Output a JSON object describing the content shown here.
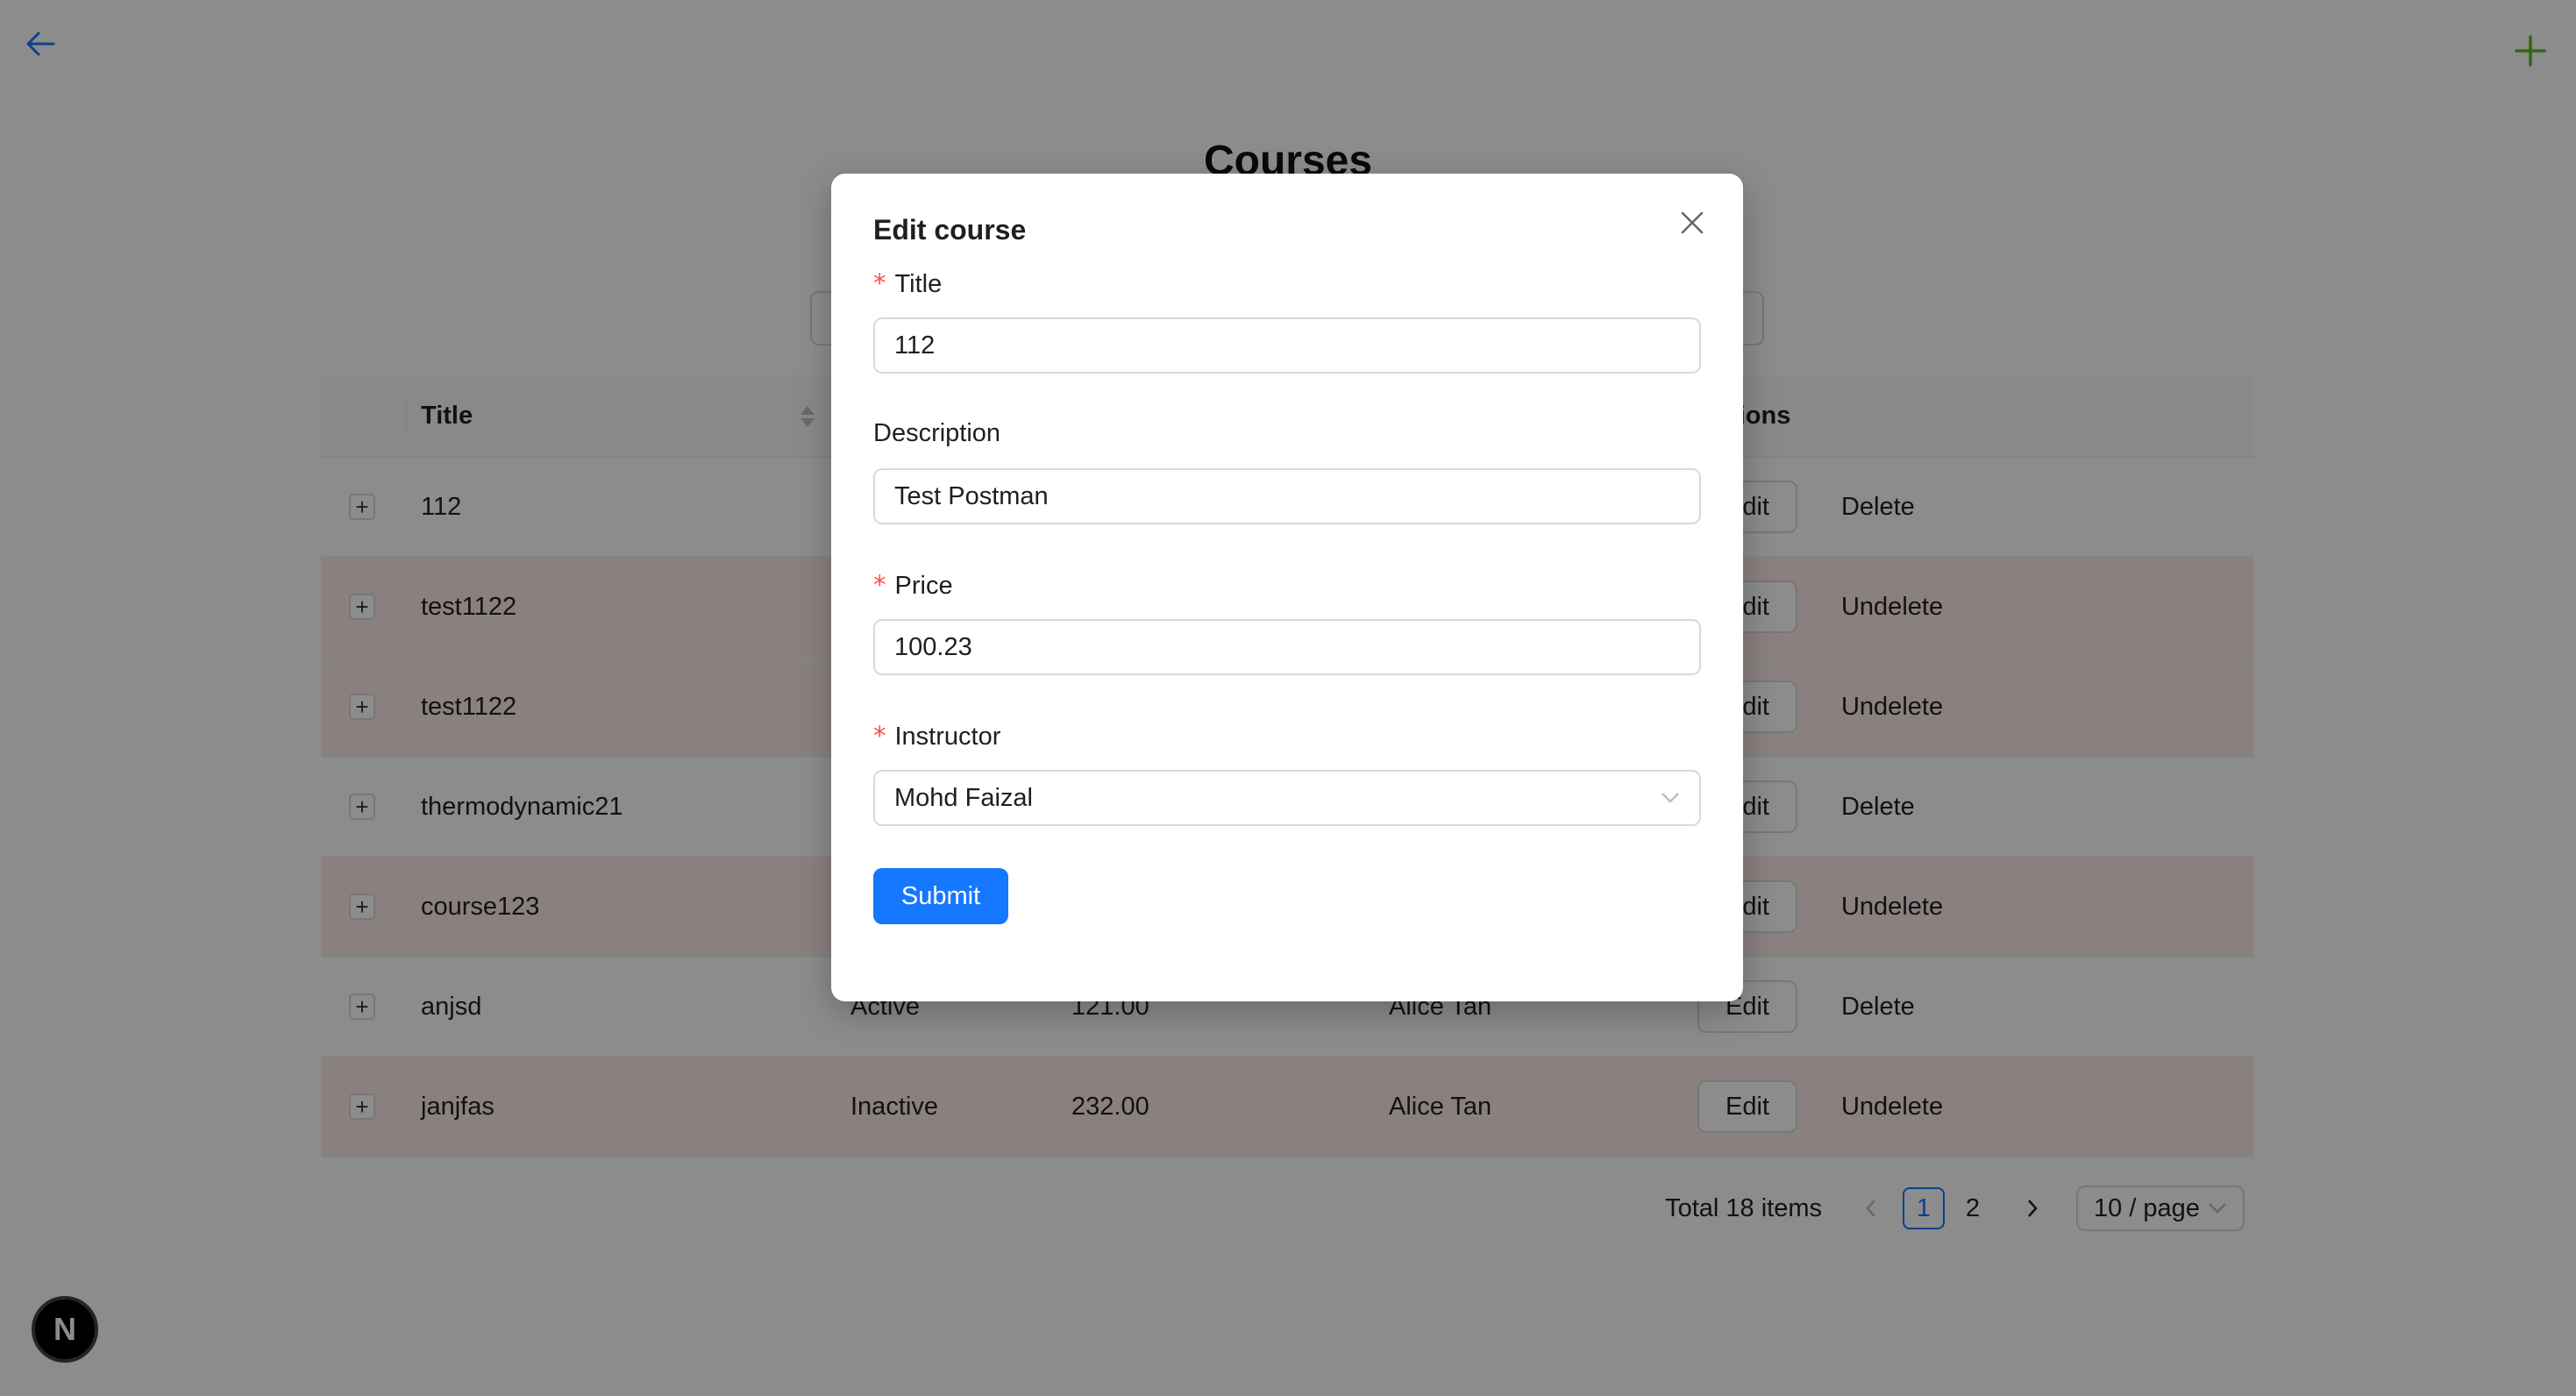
{
  "page": {
    "title": "Courses"
  },
  "table": {
    "headers": {
      "title": "Title",
      "actions": "Actions"
    },
    "rows": [
      {
        "title": "112",
        "status": "",
        "price": "",
        "instructor": "",
        "edit": "Edit",
        "action": "Delete",
        "deleted": false
      },
      {
        "title": "test1122",
        "status": "",
        "price": "",
        "instructor": "",
        "edit": "Edit",
        "action": "Undelete",
        "deleted": true
      },
      {
        "title": "test1122",
        "status": "",
        "price": "",
        "instructor": "",
        "edit": "Edit",
        "action": "Undelete",
        "deleted": true
      },
      {
        "title": "thermodynamic21",
        "status": "",
        "price": "",
        "instructor": "",
        "edit": "Edit",
        "action": "Delete",
        "deleted": false
      },
      {
        "title": "course123",
        "status": "",
        "price": "",
        "instructor": "",
        "edit": "Edit",
        "action": "Undelete",
        "deleted": true
      },
      {
        "title": "anjsd",
        "status": "Active",
        "price": "121.00",
        "instructor": "Alice Tan",
        "edit": "Edit",
        "action": "Delete",
        "deleted": false
      },
      {
        "title": "janjfas",
        "status": "Inactive",
        "price": "232.00",
        "instructor": "Alice Tan",
        "edit": "Edit",
        "action": "Undelete",
        "deleted": true
      }
    ]
  },
  "pagination": {
    "total": "Total 18 items",
    "pages": [
      "1",
      "2"
    ],
    "current": "1",
    "page_size": "10 / page"
  },
  "modal": {
    "title": "Edit course",
    "fields": {
      "title": {
        "label": "Title",
        "value": "112",
        "required": true
      },
      "description": {
        "label": "Description",
        "value": "Test Postman",
        "required": false
      },
      "price": {
        "label": "Price",
        "value": "100.23",
        "required": true
      },
      "instructor": {
        "label": "Instructor",
        "value": "Mohd Faizal",
        "required": true
      }
    },
    "submit_label": "Submit",
    "required_mark": "*"
  },
  "badge": {
    "letter": "N"
  },
  "colors": {
    "primary": "#1677ff",
    "required": "#ff4d4f",
    "deleted_row": "#fbeaea",
    "back_arrow": "#1677ff",
    "add_plus": "#52c41a"
  },
  "icons": [
    "arrow-left-icon",
    "plus-icon",
    "close-icon",
    "chevron-down-icon",
    "sort-icon",
    "expand-icon"
  ]
}
